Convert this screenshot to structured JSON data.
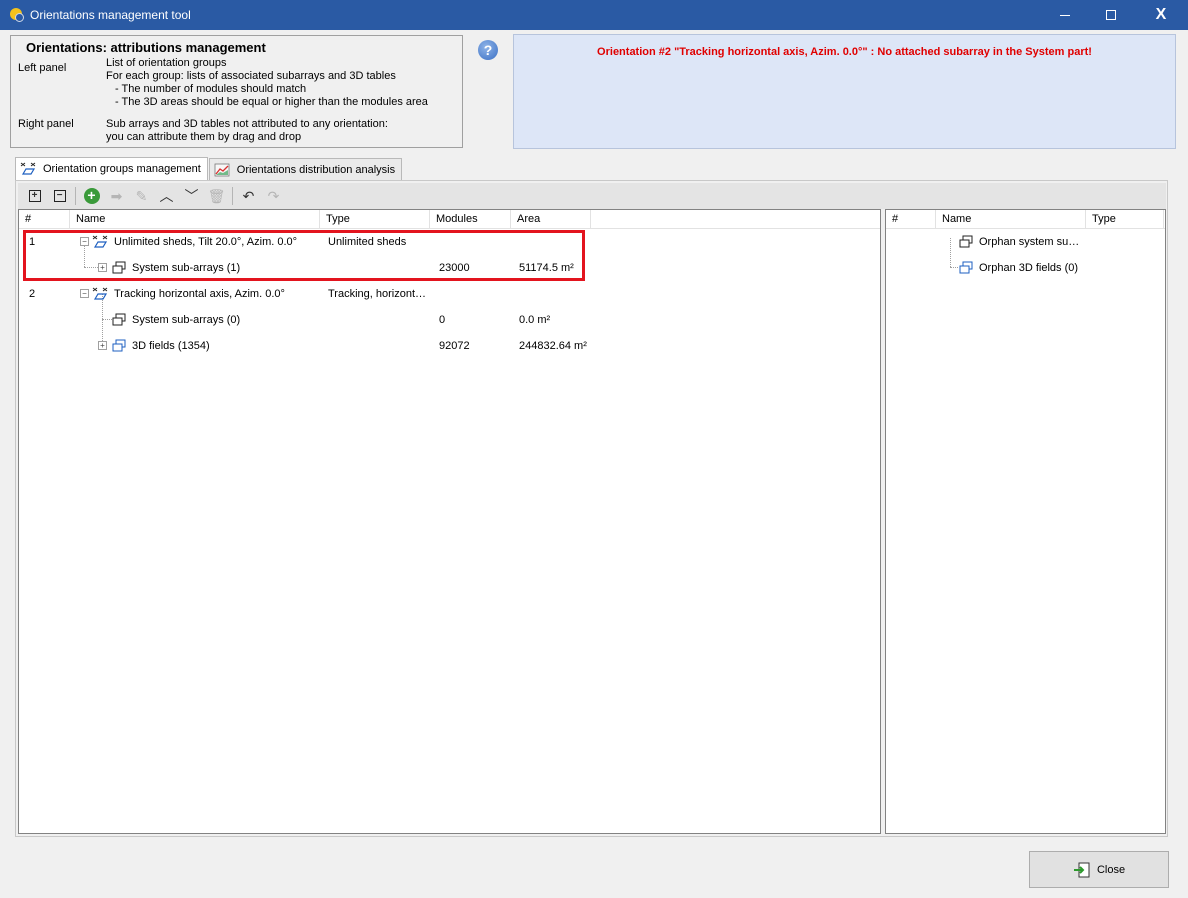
{
  "window": {
    "title": "Orientations management tool"
  },
  "info": {
    "heading": "Orientations: attributions management",
    "left_label": "Left panel",
    "left_lines": [
      "List of orientation groups",
      "For each group: lists of associated subarrays and 3D tables",
      "   - The number of modules should match",
      "   - The 3D areas should be equal or higher than the modules area"
    ],
    "right_label": "Right panel",
    "right_lines": [
      "Sub arrays and 3D tables not attributed to any orientation:",
      "you can attribute them by drag and drop"
    ]
  },
  "warning": {
    "message": "Orientation #2 \"Tracking horizontal axis, Azim. 0.0°\" : No attached subarray in the System part!"
  },
  "tabs": [
    {
      "label": "Orientation groups management",
      "active": true
    },
    {
      "label": "Orientations distribution analysis",
      "active": false
    }
  ],
  "left_table": {
    "columns": [
      "#",
      "Name",
      "Type",
      "Modules",
      "Area"
    ],
    "rows": [
      {
        "num": "1",
        "name": "Unlimited sheds, Tilt 20.0°, Azim. 0.0°",
        "type": "Unlimited sheds",
        "modules": "",
        "area": ""
      },
      {
        "num": "",
        "name": "System sub-arrays (1)",
        "type": "",
        "modules": "23000",
        "area": "51174.5 m²"
      },
      {
        "num": "2",
        "name": "Tracking horizontal axis, Azim. 0.0°",
        "type": "Tracking, horizont…",
        "modules": "",
        "area": ""
      },
      {
        "num": "",
        "name": "System sub-arrays (0)",
        "type": "",
        "modules": "0",
        "area": "0.0 m²"
      },
      {
        "num": "",
        "name": "3D fields (1354)",
        "type": "",
        "modules": "92072",
        "area": "244832.64 m²"
      }
    ]
  },
  "right_table": {
    "columns": [
      "#",
      "Name",
      "Type"
    ],
    "rows": [
      {
        "name": "Orphan system su…"
      },
      {
        "name": "Orphan 3D fields (0)"
      }
    ]
  },
  "buttons": {
    "close": "Close"
  },
  "colors": {
    "titlebar": "#2a5aa4",
    "warning_text": "#e00000",
    "warning_bg": "#dde6f7",
    "highlight": "#e3141e"
  }
}
